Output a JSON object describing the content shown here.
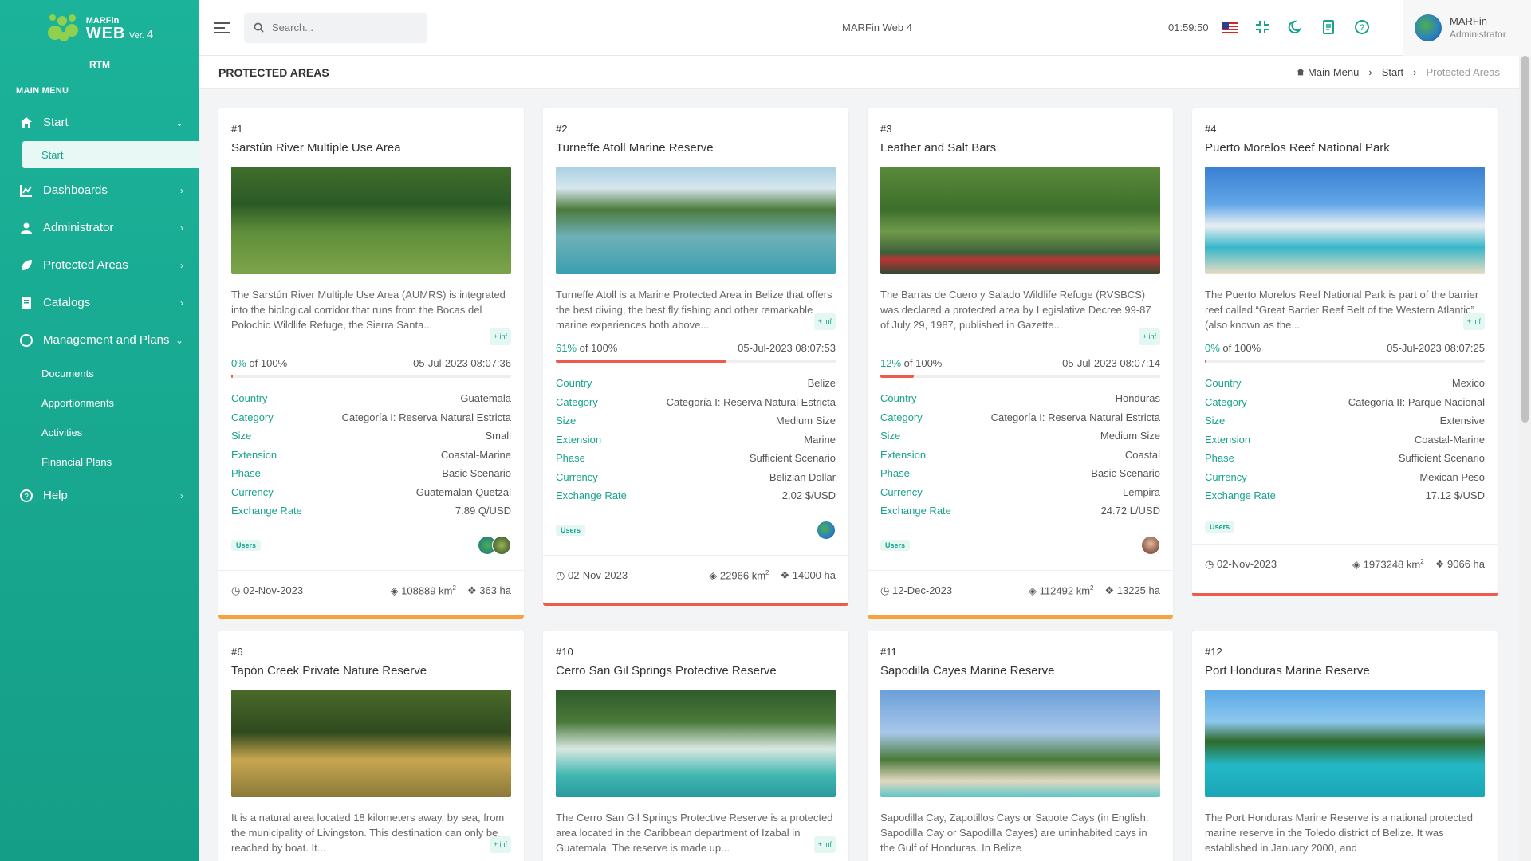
{
  "app": {
    "logo_small": "MARFin",
    "logo_big": "WEB",
    "logo_ver": "Ver.",
    "logo_ver_num": "4",
    "org": "RTM",
    "title": "MARFin Web 4",
    "clock": "01:59:50",
    "search_placeholder": "Search..."
  },
  "user": {
    "name": "MARFin",
    "role": "Administrator"
  },
  "sidebar": {
    "menu_head": "MAIN MENU",
    "start": "Start",
    "start_sub": "Start",
    "items": [
      "Dashboards",
      "Administrator",
      "Protected Areas",
      "Catalogs",
      "Management and Plans"
    ],
    "mgmt_sub": [
      "Documents",
      "Apportionments",
      "Activities",
      "Financial Plans"
    ],
    "help": "Help"
  },
  "page": {
    "title": "PROTECTED AREAS",
    "crumbs": [
      "Main Menu",
      "Start",
      "Protected Areas"
    ]
  },
  "labels": {
    "country": "Country",
    "category": "Category",
    "size": "Size",
    "extension": "Extension",
    "phase": "Phase",
    "currency": "Currency",
    "exchange": "Exchange Rate",
    "users": "Users",
    "inf": "+ inf",
    "of": "of 100%",
    "ha_unit": "ha",
    "km_unit": "km"
  },
  "colors": {
    "accent": "#17a38c",
    "progress": "#ef5b4a",
    "stripe_orange": "#f7a23b",
    "stripe_red": "#ef5b4a"
  },
  "cards": [
    {
      "num": "#1",
      "title": "Sarstún River Multiple Use Area",
      "desc": "The Sarstún River Multiple Use Area (AUMRS) is integrated into the biological corridor that runs from the Bocas del Polochic Wildlife Refuge, the Sierra Santa...",
      "progress_pct": "0%",
      "progress_value": 0,
      "date": "05-Jul-2023 08:07:36",
      "country": "Guatemala",
      "category": "Categoría I: Reserva Natural Estricta",
      "size": "Small",
      "extension": "Coastal-Marine",
      "phase": "Basic Scenario",
      "currency": "Guatemalan Quetzal",
      "exchange": "7.89 Q/USD",
      "foot_date": "02-Nov-2023",
      "km": "108889",
      "ha": "363 ha",
      "stripe": "orange",
      "users": 2
    },
    {
      "num": "#2",
      "title": "Turneffe Atoll Marine Reserve",
      "desc": "Turneffe Atoll is a Marine Protected Area in Belize that offers the best diving, the best fly fishing and other remarkable marine experiences both above...",
      "progress_pct": "61%",
      "progress_value": 61,
      "date": "05-Jul-2023 08:07:53",
      "country": "Belize",
      "category": "Categoría I: Reserva Natural Estricta",
      "size": "Medium Size",
      "extension": "Marine",
      "phase": "Sufficient Scenario",
      "currency": "Belizian Dollar",
      "exchange": "2.02 $/USD",
      "foot_date": "02-Nov-2023",
      "km": "22966",
      "ha": "14000 ha",
      "stripe": "red",
      "users": 1
    },
    {
      "num": "#3",
      "title": "Leather and Salt Bars",
      "desc": "The Barras de Cuero y Salado Wildlife Refuge (RVSBCS) was declared a protected area by Legislative Decree 99-87 of July 29, 1987, published in Gazette...",
      "progress_pct": "12%",
      "progress_value": 12,
      "date": "05-Jul-2023 08:07:14",
      "country": "Honduras",
      "category": "Categoría I: Reserva Natural Estricta",
      "size": "Medium Size",
      "extension": "Coastal",
      "phase": "Basic Scenario",
      "currency": "Lempira",
      "exchange": "24.72 L/USD",
      "foot_date": "12-Dec-2023",
      "km": "112492",
      "ha": "13225 ha",
      "stripe": "orange",
      "users": 1
    },
    {
      "num": "#4",
      "title": "Puerto Morelos Reef National Park",
      "desc": "The Puerto Morelos Reef National Park is part of the barrier reef called “Great Barrier Reef Belt of the Western Atlantic” (also known as the...",
      "progress_pct": "0%",
      "progress_value": 0,
      "date": "05-Jul-2023 08:07:25",
      "country": "Mexico",
      "category": "Categoría II: Parque Nacional",
      "size": "Extensive",
      "extension": "Coastal-Marine",
      "phase": "Sufficient Scenario",
      "currency": "Mexican Peso",
      "exchange": "17.12 $/USD",
      "foot_date": "02-Nov-2023",
      "km": "1973248",
      "ha": "9066 ha",
      "stripe": "red",
      "users": 0
    },
    {
      "num": "#6",
      "title": "Tapón Creek Private Nature Reserve",
      "desc": "It is a natural area located 18 kilometers away, by sea, from the municipality of Livingston. This destination can only be reached by boat. It..."
    },
    {
      "num": "#10",
      "title": "Cerro San Gil Springs Protective Reserve",
      "desc": "The Cerro San Gil Springs Protective Reserve is a protected area located in the Caribbean department of Izabal in Guatemala. The reserve is made up..."
    },
    {
      "num": "#11",
      "title": "Sapodilla Cayes Marine Reserve",
      "desc": "Sapodilla Cay, Zapotillos Cays or Sapote Cays (in English: Sapodilla Cay or Sapodilla Cayes) are uninhabited cays in the Gulf of Honduras. In Belize"
    },
    {
      "num": "#12",
      "title": "Port Honduras Marine Reserve",
      "desc": "The Port Honduras Marine Reserve is a national protected marine reserve in the Toledo district of Belize. It was established in January 2000, and"
    }
  ]
}
